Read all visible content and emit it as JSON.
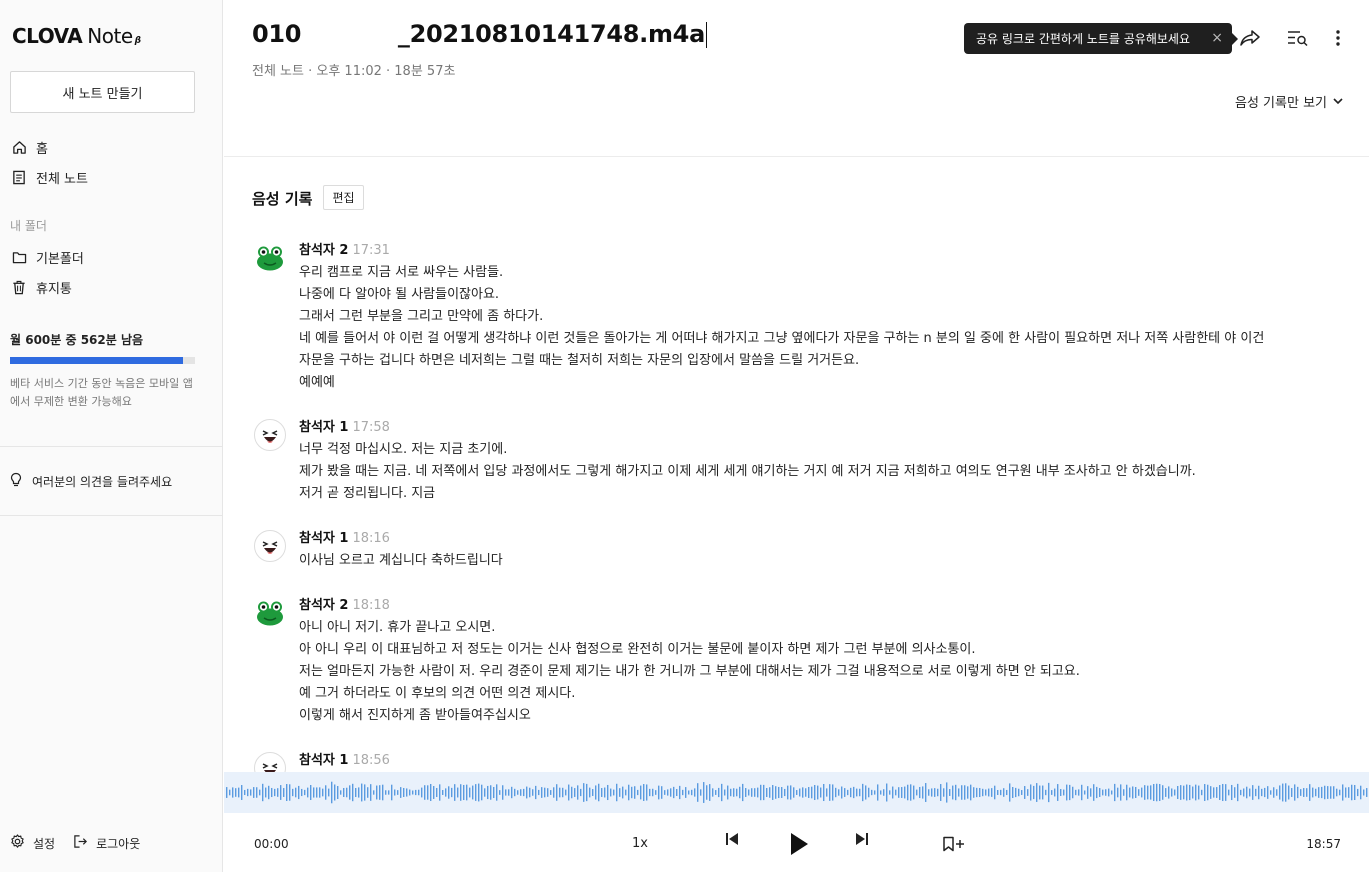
{
  "sidebar": {
    "logo_brand": "CLOVA",
    "logo_product": "Note",
    "logo_badge": "β",
    "new_note": "새 노트 만들기",
    "nav": [
      {
        "label": "홈",
        "icon": "home-icon"
      },
      {
        "label": "전체 노트",
        "icon": "document-icon"
      }
    ],
    "folder_header": "내 폴더",
    "folders": [
      {
        "label": "기본폴더",
        "icon": "folder-icon"
      },
      {
        "label": "휴지통",
        "icon": "trash-icon"
      }
    ],
    "quota_text": "월 600분 중 562분 남음",
    "quota_remaining_fraction": 0.937,
    "quota_note": "베타 서비스 기간 동안 녹음은 모바일 앱에서 무제한 변환 가능해요",
    "feedback": "여러분의 의견을 들려주세요",
    "settings": "설정",
    "logout": "로그아웃"
  },
  "header": {
    "title": "010            _20210810141748.m4a",
    "meta": "전체 노트 · 오후 11:02 · 18분 57초",
    "tooltip": "공유 링크로 간편하게 노트를 공유해보세요",
    "tooltip_close": "×",
    "view_toggle": "음성 기록만 보기"
  },
  "transcript": {
    "section_title": "음성 기록",
    "edit_label": "편집",
    "utterances": [
      {
        "speaker": "참석자 2",
        "time": "17:31",
        "avatar": "frog",
        "lines": [
          "우리 캠프로 지금 서로 싸우는 사람들.",
          "나중에 다 알아야 될 사람들이잖아요.",
          "그래서 그런 부분을 그리고 만약에 좀 하다가.",
          "네 예를 들어서 야 이런 걸 어떻게 생각하냐 이런 것들은 돌아가는 게 어떠냐 해가지고 그냥 옆에다가 자문을 구하는 n 분의 일 중에 한 사람이 필요하면 저나 저쪽 사람한테 야 이건",
          "자문을 구하는 겁니다 하면은 네저희는 그럴 때는 철저히 저희는 자문의 입장에서 말씀을 드릴 거거든요.",
          "예예예"
        ]
      },
      {
        "speaker": "참석자 1",
        "time": "17:58",
        "avatar": "face",
        "lines": [
          "너무 걱정 마십시오. 저는 지금 초기에.",
          "제가 봤을 때는 지금. 네 저쪽에서 입당 과정에서도 그렇게 해가지고 이제 세게 세게 얘기하는 거지 예 저거 지금 저희하고 여의도 연구원 내부 조사하고 안 하겠습니까.",
          "저거 곧 정리됩니다. 지금"
        ]
      },
      {
        "speaker": "참석자 1",
        "time": "18:16",
        "avatar": "face",
        "lines": [
          "이사님 오르고 계십니다 축하드립니다"
        ]
      },
      {
        "speaker": "참석자 2",
        "time": "18:18",
        "avatar": "frog",
        "lines": [
          "아니 아니 저기. 휴가 끝나고 오시면.",
          "아 아니 우리 이 대표님하고 저 정도는 이거는 신사 협정으로 완전히 이거는 불문에 붙이자 하면 제가 그런 부분에 의사소통이.",
          "저는 얼마든지 가능한 사람이 저. 우리 경준이 문제 제기는 내가 한 거니까 그 부분에 대해서는 제가 그걸 내용적으로 서로 이렇게 하면 안 되고요.",
          "예 그거 하더라도 이 후보의 의견 어떤 의견 제시다.",
          "이렇게 해서 진지하게 좀 받아들여주십시오"
        ]
      },
      {
        "speaker": "참석자 1",
        "time": "18:56",
        "avatar": "face",
        "lines": []
      }
    ]
  },
  "player": {
    "current_time": "00:00",
    "total_time": "18:57",
    "speed": "1x",
    "wave_color": "#5a9be0",
    "wave_bg": "#e9f1fb"
  },
  "colors": {
    "accent": "#2f6be0",
    "frog_green": "#1e9a3c"
  }
}
